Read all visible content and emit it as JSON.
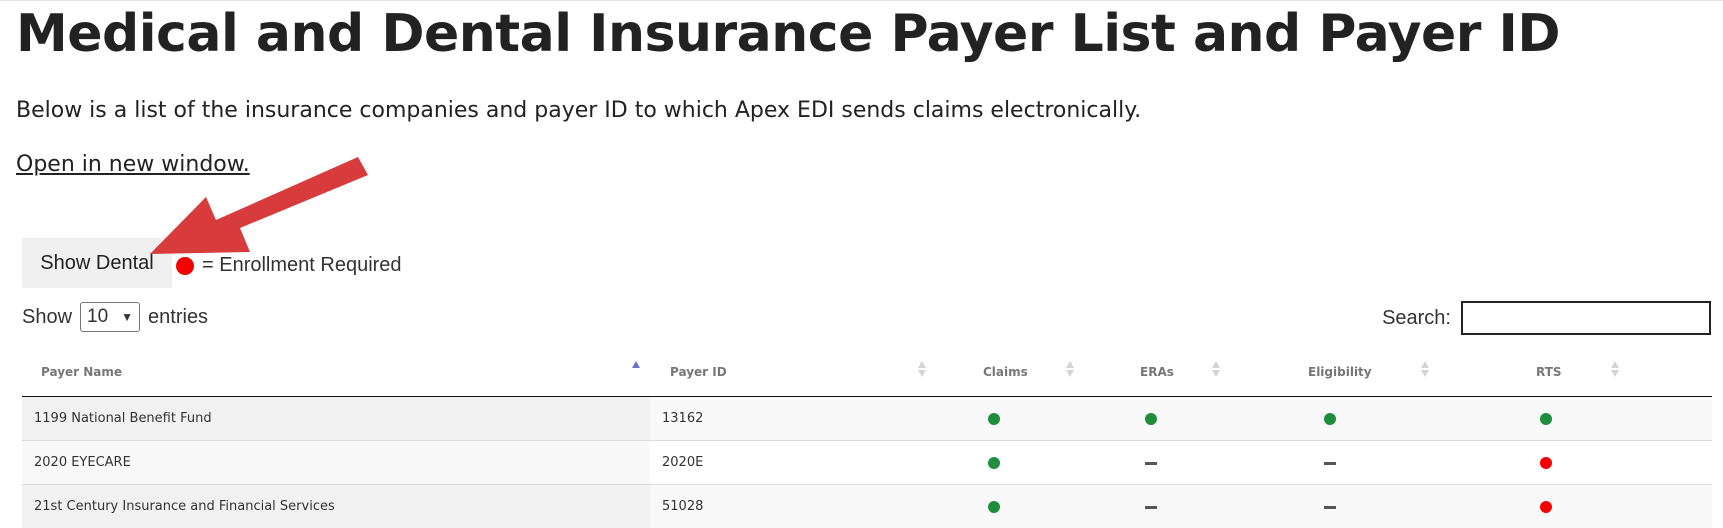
{
  "page": {
    "title": "Medical and Dental Insurance Payer List and Payer ID",
    "intro": "Below is a list of the insurance companies and payer ID to which Apex EDI sends claims electronically.",
    "open_link": "Open in new window."
  },
  "controls": {
    "show_dental_label": "Show Dental",
    "legend_text": "= Enrollment Required",
    "legend_dot_color": "#f50000",
    "length_prefix": "Show",
    "length_value": "10",
    "length_suffix": "entries",
    "search_label": "Search:",
    "search_value": ""
  },
  "table": {
    "columns": {
      "payer_name": "Payer Name",
      "payer_id": "Payer ID",
      "claims": "Claims",
      "eras": "ERAs",
      "eligibility": "Eligibility",
      "rts": "RTS"
    },
    "sorted_column": "Payer Name",
    "sort_direction": "ascending",
    "status_legend": {
      "green": "supported",
      "dash": "not supported",
      "red": "enrollment required"
    },
    "status_colors": {
      "green": "#1e8e3e",
      "red": "#f50000",
      "dash": "#555555"
    },
    "rows": [
      {
        "name": "1199 National Benefit Fund",
        "id": "13162",
        "claims": "green",
        "eras": "green",
        "eligibility": "green",
        "rts": "green"
      },
      {
        "name": "2020 EYECARE",
        "id": "2020E",
        "claims": "green",
        "eras": "dash",
        "eligibility": "dash",
        "rts": "red"
      },
      {
        "name": "21st Century Insurance and Financial Services",
        "id": "51028",
        "claims": "green",
        "eras": "dash",
        "eligibility": "dash",
        "rts": "red"
      }
    ]
  },
  "annotation": {
    "arrow_color": "#d83b3b",
    "arrow_target": "Show Dental"
  }
}
